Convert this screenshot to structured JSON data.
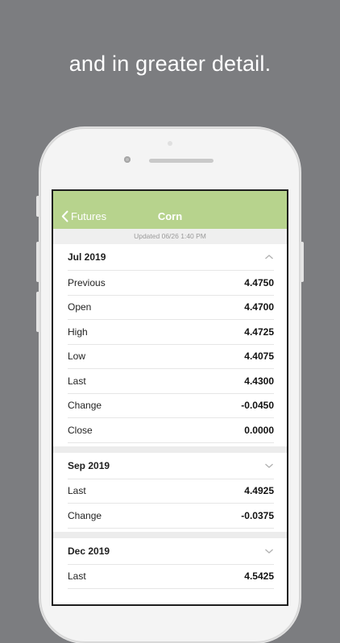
{
  "headline": "and in greater detail.",
  "colors": {
    "background": "#7c7d80",
    "navbar": "#b7d38d",
    "text": "#222222"
  },
  "navbar": {
    "back_label": "Futures",
    "back_icon": "chevron-left-icon",
    "title": "Corn"
  },
  "updated": "Updated 06/26 1:40 PM",
  "sections": [
    {
      "title": "Jul 2019",
      "state": "expanded",
      "icon": "chevron-up-icon",
      "rows": [
        {
          "label": "Previous",
          "value": "4.4750"
        },
        {
          "label": "Open",
          "value": "4.4700"
        },
        {
          "label": "High",
          "value": "4.4725"
        },
        {
          "label": "Low",
          "value": "4.4075"
        },
        {
          "label": "Last",
          "value": "4.4300"
        },
        {
          "label": "Change",
          "value": "-0.0450"
        },
        {
          "label": "Close",
          "value": "0.0000"
        }
      ]
    },
    {
      "title": "Sep 2019",
      "state": "collapsed",
      "icon": "chevron-down-icon",
      "rows": [
        {
          "label": "Last",
          "value": "4.4925"
        },
        {
          "label": "Change",
          "value": "-0.0375"
        }
      ]
    },
    {
      "title": "Dec 2019",
      "state": "collapsed",
      "icon": "chevron-down-icon",
      "rows": [
        {
          "label": "Last",
          "value": "4.5425"
        }
      ]
    }
  ]
}
